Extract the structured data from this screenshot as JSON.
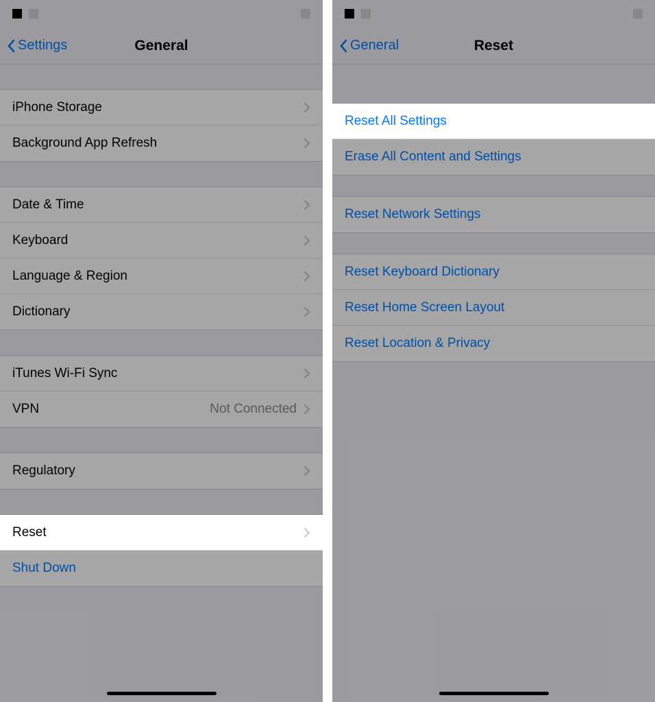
{
  "left": {
    "nav": {
      "back": "Settings",
      "title": "General"
    },
    "groups": [
      {
        "items": [
          {
            "label": "iPhone Storage",
            "chevron": true
          },
          {
            "label": "Background App Refresh",
            "chevron": true
          }
        ]
      },
      {
        "items": [
          {
            "label": "Date & Time",
            "chevron": true
          },
          {
            "label": "Keyboard",
            "chevron": true
          },
          {
            "label": "Language & Region",
            "chevron": true
          },
          {
            "label": "Dictionary",
            "chevron": true
          }
        ]
      },
      {
        "items": [
          {
            "label": "iTunes Wi-Fi Sync",
            "chevron": true
          },
          {
            "label": "VPN",
            "value": "Not Connected",
            "chevron": true
          }
        ]
      },
      {
        "items": [
          {
            "label": "Regulatory",
            "chevron": true
          }
        ]
      },
      {
        "items": [
          {
            "label": "Reset",
            "chevron": true,
            "highlight": true
          },
          {
            "label": "Shut Down",
            "blue": true
          }
        ]
      }
    ]
  },
  "right": {
    "nav": {
      "back": "General",
      "title": "Reset"
    },
    "groups": [
      {
        "items": [
          {
            "label": "Reset All Settings",
            "blue": true,
            "highlight": true
          },
          {
            "label": "Erase All Content and Settings",
            "blue": true
          }
        ]
      },
      {
        "items": [
          {
            "label": "Reset Network Settings",
            "blue": true
          }
        ]
      },
      {
        "items": [
          {
            "label": "Reset Keyboard Dictionary",
            "blue": true
          },
          {
            "label": "Reset Home Screen Layout",
            "blue": true
          },
          {
            "label": "Reset Location & Privacy",
            "blue": true
          }
        ]
      }
    ]
  }
}
